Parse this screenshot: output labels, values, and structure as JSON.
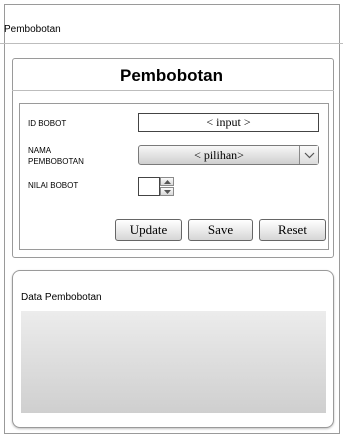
{
  "window": {
    "title": "Pembobotan"
  },
  "panel": {
    "heading": "Pembobotan"
  },
  "form": {
    "id_bobot": {
      "label": "ID BOBOT",
      "value": "< input >"
    },
    "nama_pembobotan": {
      "label_line1": "NAMA",
      "label_line2": "PEMBOBOTAN",
      "value": "< pilihan>"
    },
    "nilai_bobot": {
      "label": "NILAI BOBOT",
      "value": ""
    }
  },
  "buttons": {
    "update": "Update",
    "save": "Save",
    "reset": "Reset"
  },
  "data_section": {
    "label": "Data Pembobotan"
  }
}
